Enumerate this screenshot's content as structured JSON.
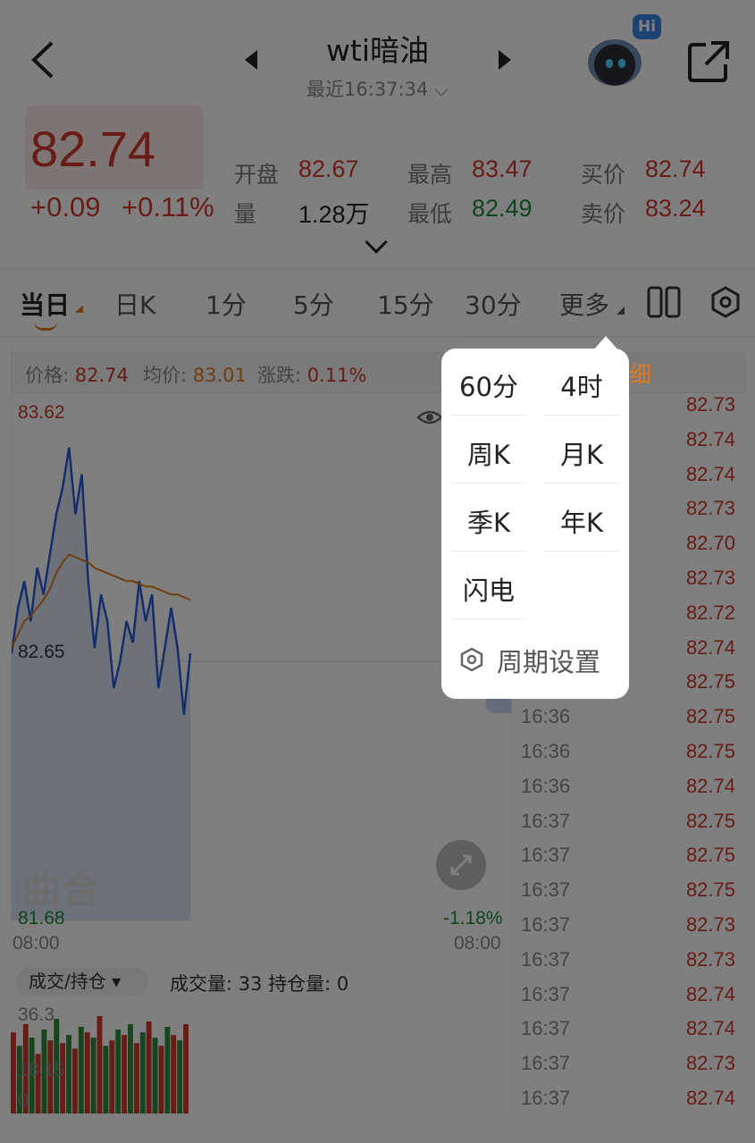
{
  "header": {
    "title": "wti暗油",
    "subtitle": "最近16:37:34",
    "hi_badge": "Hi"
  },
  "quote": {
    "price": "82.74",
    "change": "+0.09",
    "change_pct": "+0.11%",
    "open_label": "开盘",
    "open": "82.67",
    "high_label": "最高",
    "high": "83.47",
    "bid_label": "买价",
    "bid": "82.74",
    "vol_label": "量",
    "vol": "1.28万",
    "low_label": "最低",
    "low": "82.49",
    "ask_label": "卖价",
    "ask": "83.24"
  },
  "tabs": [
    {
      "label": "当日"
    },
    {
      "label": "日K"
    },
    {
      "label": "1分"
    },
    {
      "label": "5分"
    },
    {
      "label": "15分"
    },
    {
      "label": "30分"
    },
    {
      "label": "更多"
    }
  ],
  "info_bar": {
    "price_label": "价格:",
    "price": "82.74",
    "avg_label": "均价:",
    "avg": "83.01",
    "chg_label": "涨跌:",
    "chg": "0.11%"
  },
  "chart": {
    "y_top": "83.62",
    "y_mid": "82.65",
    "y_bottom": "81.68",
    "pct_bottom": "-1.18%",
    "x_start": "08:00",
    "x_end": "08:00",
    "watermark": "曲合"
  },
  "volume": {
    "select_label": "成交/持仓",
    "summary": "成交量: 33 持仓量: 0",
    "y_top": "36.3",
    "y_mid": "18.15",
    "y_bottom": "0"
  },
  "detail_tab": "细",
  "list": [
    {
      "time": "",
      "price": "82.73"
    },
    {
      "time": "",
      "price": "82.74"
    },
    {
      "time": "",
      "price": "82.74"
    },
    {
      "time": "",
      "price": "82.73"
    },
    {
      "time": "",
      "price": "82.70"
    },
    {
      "time": "",
      "price": "82.73"
    },
    {
      "time": "",
      "price": "82.72"
    },
    {
      "time": "",
      "price": "82.74"
    },
    {
      "time": "",
      "price": "82.75"
    },
    {
      "time": "16:36",
      "price": "82.75"
    },
    {
      "time": "16:36",
      "price": "82.75"
    },
    {
      "time": "16:36",
      "price": "82.74"
    },
    {
      "time": "16:37",
      "price": "82.75"
    },
    {
      "time": "16:37",
      "price": "82.75"
    },
    {
      "time": "16:37",
      "price": "82.75"
    },
    {
      "time": "16:37",
      "price": "82.73"
    },
    {
      "time": "16:37",
      "price": "82.73"
    },
    {
      "time": "16:37",
      "price": "82.74"
    },
    {
      "time": "16:37",
      "price": "82.74"
    },
    {
      "time": "16:37",
      "price": "82.73"
    },
    {
      "time": "16:37",
      "price": "82.74"
    }
  ],
  "popup": {
    "items": [
      "60分",
      "4时",
      "周K",
      "月K",
      "季K",
      "年K",
      "闪电"
    ],
    "setting": "周期设置"
  },
  "chart_data": {
    "type": "line",
    "series": [
      {
        "values": [
          82.68,
          82.85,
          82.95,
          82.8,
          83.0,
          82.9,
          83.05,
          83.2,
          83.3,
          83.45,
          83.2,
          83.35,
          82.95,
          82.7,
          82.9,
          82.8,
          82.55,
          82.65,
          82.8,
          82.72,
          82.95,
          82.8,
          82.9,
          82.55,
          82.7,
          82.85,
          82.7,
          82.45,
          82.68
        ]
      },
      {
        "values": [
          82.7,
          82.75,
          82.8,
          82.82,
          82.85,
          82.88,
          82.92,
          82.98,
          83.02,
          83.05,
          83.04,
          83.03,
          83.02,
          83.0,
          82.99,
          82.98,
          82.97,
          82.96,
          82.95,
          82.95,
          82.94,
          82.93,
          82.93,
          82.92,
          82.91,
          82.9,
          82.9,
          82.89,
          82.88
        ]
      }
    ],
    "ylim": [
      81.68,
      83.62
    ],
    "volume": [
      30,
      25,
      33,
      28,
      22,
      31,
      27,
      35,
      26,
      29,
      24,
      32,
      30,
      28,
      36,
      25,
      27,
      31,
      29,
      33,
      26,
      30,
      34,
      28,
      25,
      32,
      29,
      27,
      33
    ]
  }
}
